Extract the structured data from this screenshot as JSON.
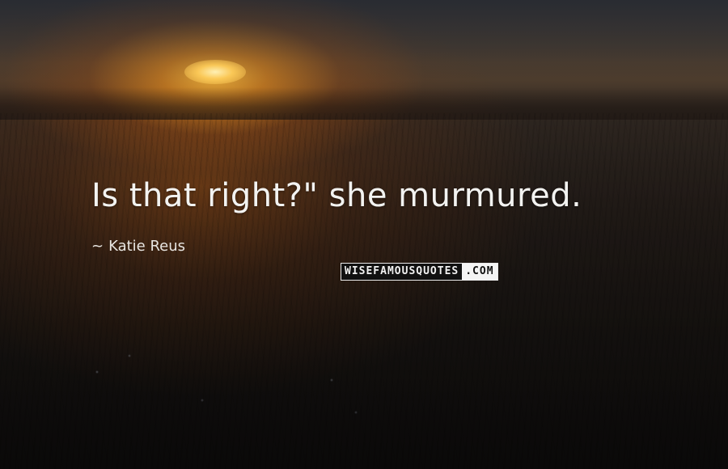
{
  "quote": {
    "text": "Is that right?\" she murmured."
  },
  "author": {
    "dash": "~",
    "name": "Katie Reus"
  },
  "brand": {
    "main": "WISEFAMOUSQUOTES",
    "tail": ".COM"
  },
  "colors": {
    "quote_text": "#f3f3f1",
    "brand_dark": "#111111",
    "brand_light": "#f4f4f4",
    "sun": "#ffcd5a"
  }
}
